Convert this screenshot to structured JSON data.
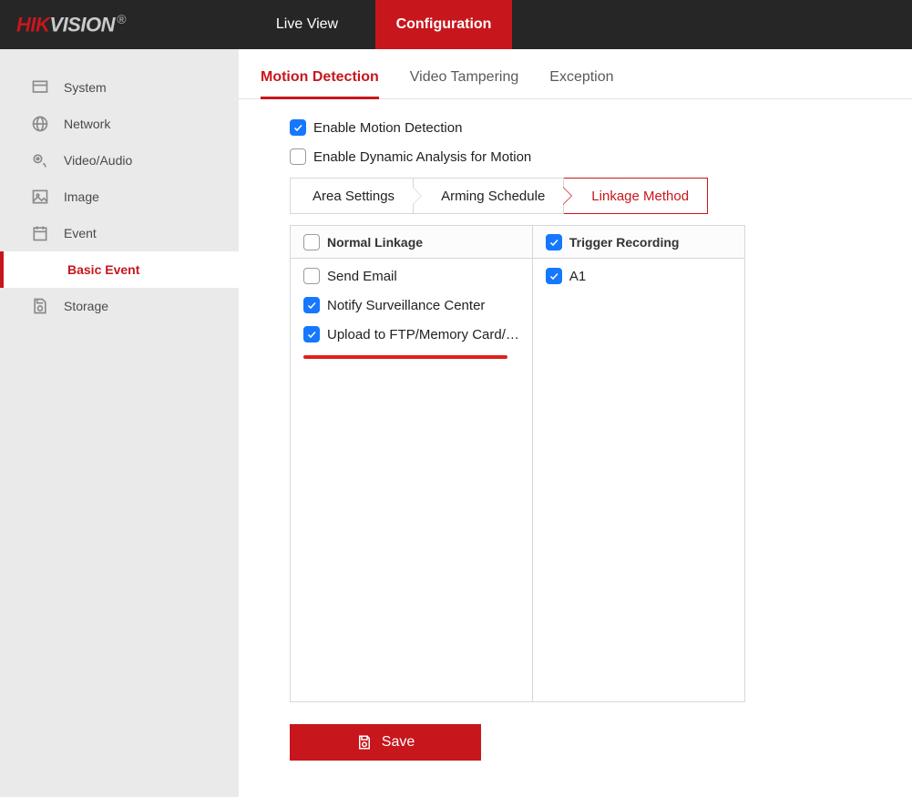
{
  "brand": {
    "hik": "HIK",
    "vision": "VISION",
    "reg": "®"
  },
  "topnav": {
    "live_view": "Live View",
    "configuration": "Configuration"
  },
  "sidebar": {
    "system": "System",
    "network": "Network",
    "video_audio": "Video/Audio",
    "image": "Image",
    "event": "Event",
    "basic_event": "Basic Event",
    "storage": "Storage"
  },
  "subtabs": {
    "motion": "Motion Detection",
    "tamper": "Video Tampering",
    "exception": "Exception"
  },
  "options": {
    "enable_motion": "Enable Motion Detection",
    "enable_dynamic": "Enable Dynamic Analysis for Motion"
  },
  "steps": {
    "area": "Area Settings",
    "arming": "Arming Schedule",
    "linkage": "Linkage Method"
  },
  "linkage": {
    "normal_header": "Normal Linkage",
    "trigger_header": "Trigger Recording",
    "send_email": "Send Email",
    "notify": "Notify Surveillance Center",
    "upload": "Upload to FTP/Memory Card/…",
    "a1": "A1"
  },
  "save": "Save",
  "state": {
    "enable_motion": true,
    "enable_dynamic": false,
    "normal_header_chk": false,
    "send_email": false,
    "notify": true,
    "upload": true,
    "trigger_header_chk": true,
    "a1": true
  }
}
